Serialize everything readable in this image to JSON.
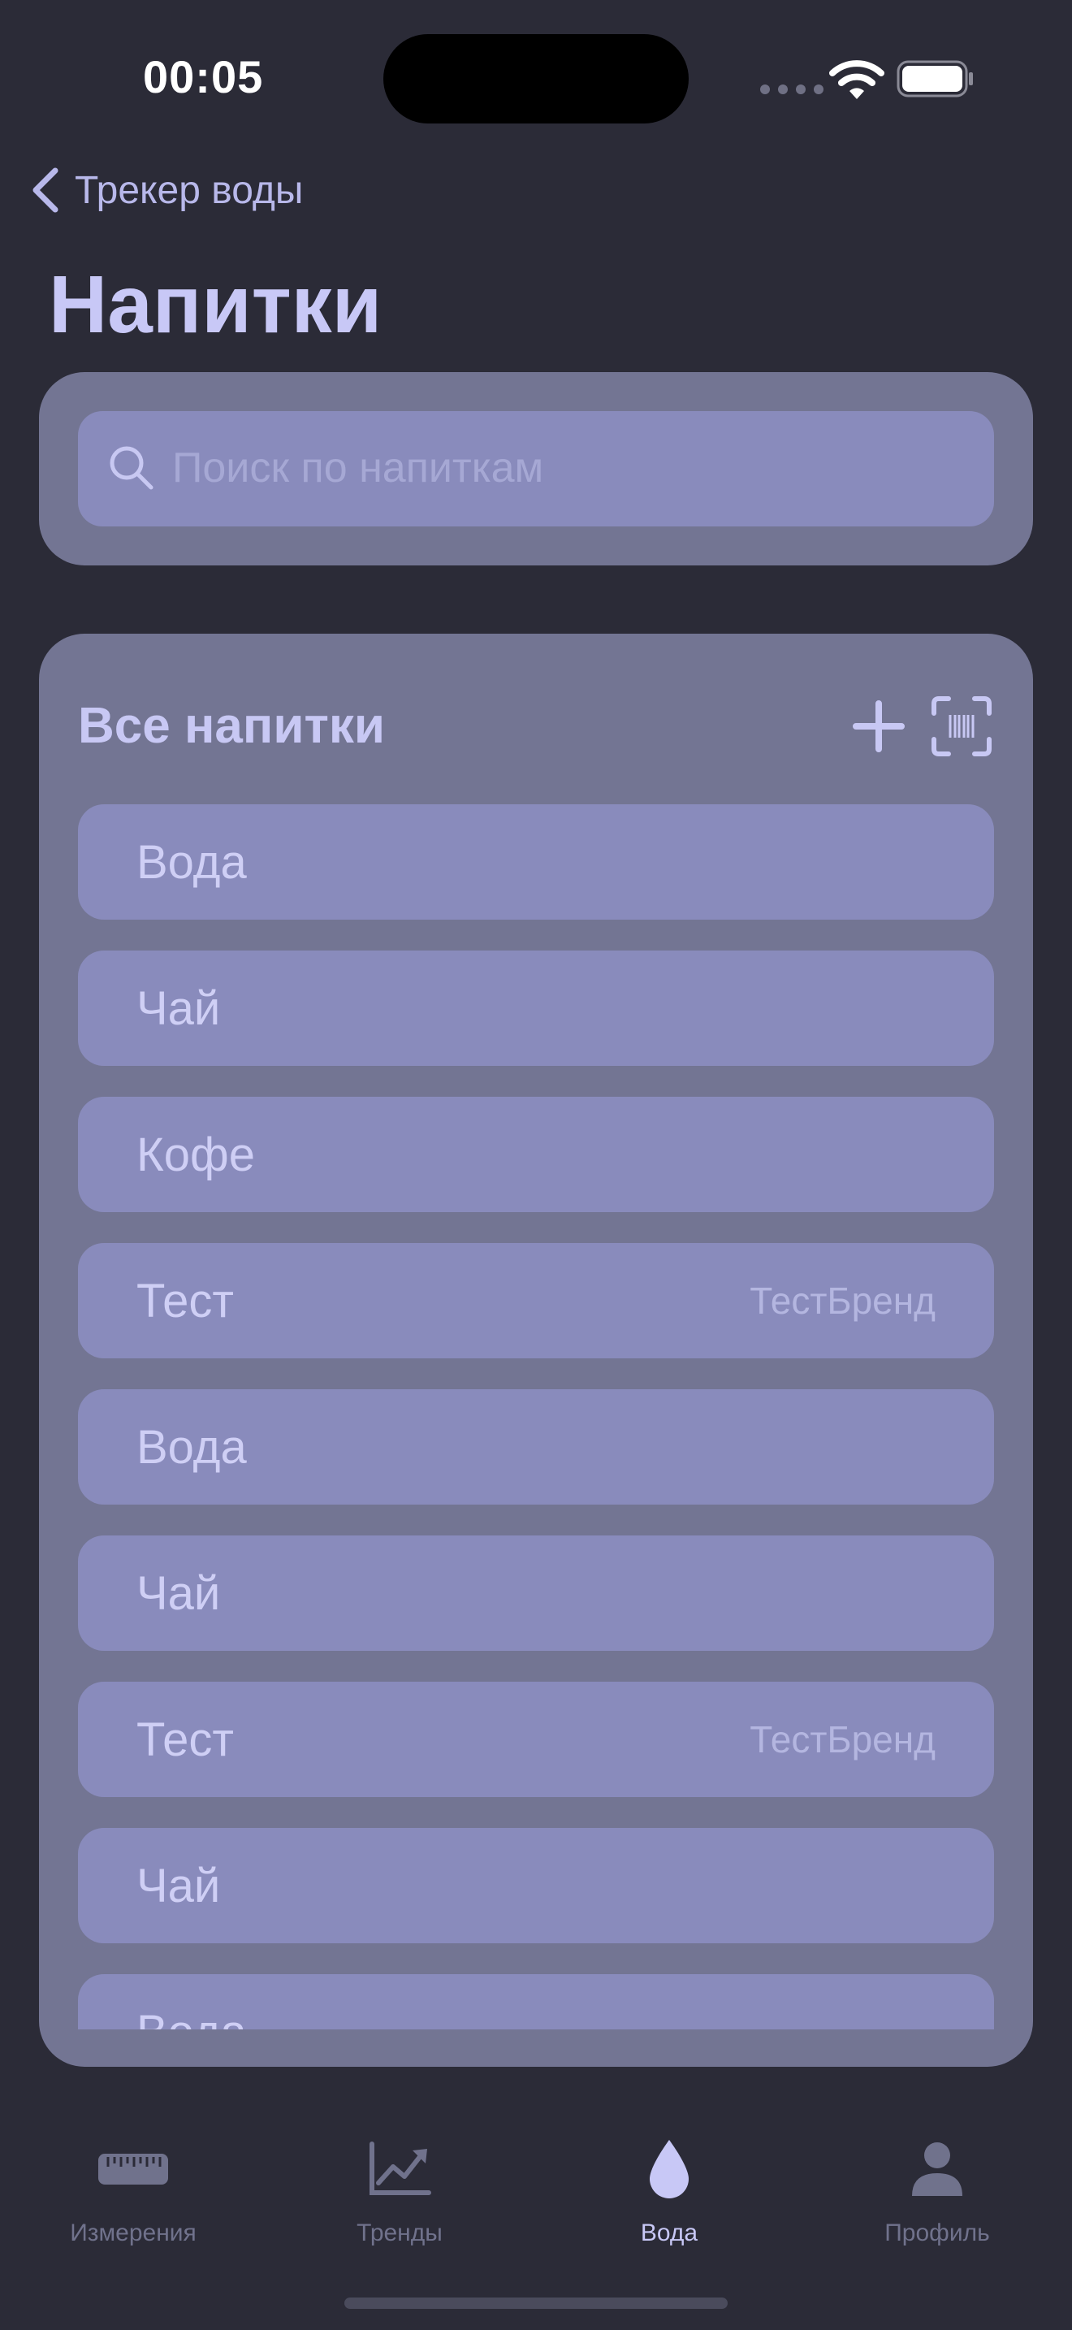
{
  "status_bar": {
    "time": "00:05"
  },
  "nav": {
    "back_label": "Трекер воды",
    "title": "Напитки"
  },
  "search": {
    "placeholder": "Поиск по напиткам",
    "value": ""
  },
  "list": {
    "title": "Все напитки",
    "items": [
      {
        "name": "Вода",
        "brand": ""
      },
      {
        "name": "Чай",
        "brand": ""
      },
      {
        "name": "Кофе",
        "brand": ""
      },
      {
        "name": "Тест",
        "brand": "ТестБренд"
      },
      {
        "name": "Вода",
        "brand": ""
      },
      {
        "name": "Чай",
        "brand": ""
      },
      {
        "name": "Тест",
        "brand": "ТестБренд"
      },
      {
        "name": "Чай",
        "brand": ""
      },
      {
        "name": "Вода",
        "brand": ""
      }
    ]
  },
  "tabs": [
    {
      "label": "Измерения",
      "icon": "ruler-icon",
      "active": false
    },
    {
      "label": "Тренды",
      "icon": "chart-trend-icon",
      "active": false
    },
    {
      "label": "Вода",
      "icon": "water-drop-icon",
      "active": true
    },
    {
      "label": "Профиль",
      "icon": "person-icon",
      "active": false
    }
  ],
  "colors": {
    "background": "#2b2b37",
    "card": "#737593",
    "row": "#898bbc",
    "accent": "#c8c8f6",
    "inactive_tab": "#70728c"
  }
}
